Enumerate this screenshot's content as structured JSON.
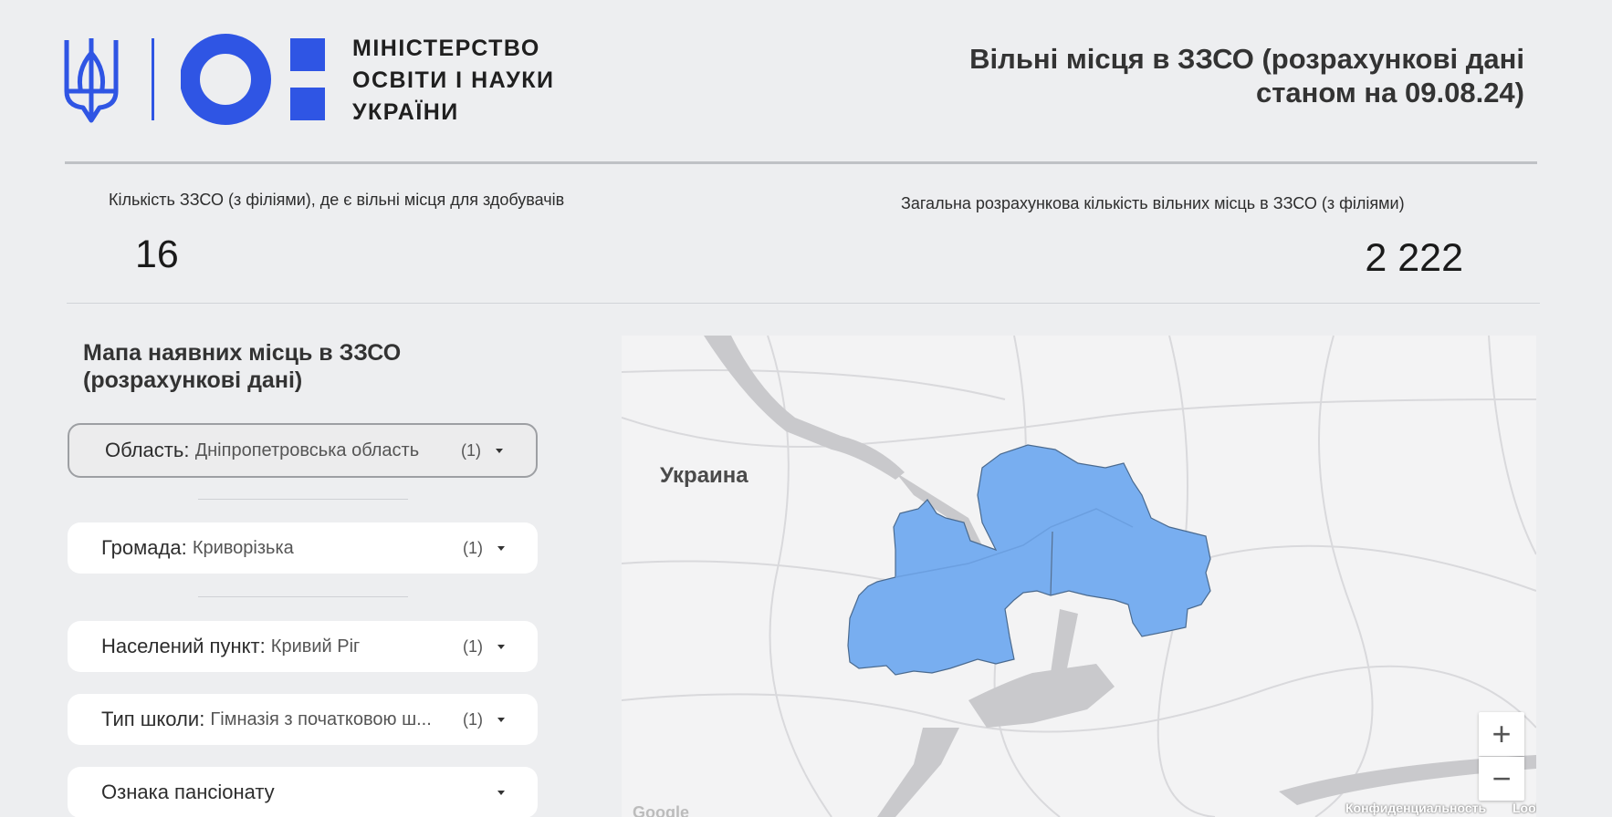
{
  "header": {
    "ministry_lines": [
      "МІНІСТЕРСТВО",
      "ОСВІТИ І НАУКИ",
      "УКРАЇНИ"
    ],
    "report_title_line1": "Вільні місця в ЗЗСО (розрахункові дані",
    "report_title_line2": "станом на 09.08.24)",
    "brand_color": "#2f55e4"
  },
  "kpis": [
    {
      "label": "Кількість ЗЗСО (з філіями), де є вільні місця для здобувачів",
      "value": "16"
    },
    {
      "label": "Загальна розрахункова кількість вільних місць в ЗЗСО (з філіями)",
      "value": "2 222"
    }
  ],
  "panel": {
    "title_line1": "Мапа наявних місць в ЗЗСО",
    "title_line2": "(розрахункові дані)"
  },
  "filters": [
    {
      "name": "Область",
      "value": "Дніпропетровська область",
      "count": "(1)",
      "active": true
    },
    {
      "name": "Громада",
      "value": "Криворізька",
      "count": "(1)"
    },
    {
      "name": "Населений пункт",
      "value": "Кривий Ріг",
      "count": "(1)"
    },
    {
      "name": "Тип школи",
      "value": "Гімназія з початковою ш...",
      "count": "(1)"
    },
    {
      "name": "Ознака пансіонату",
      "value": "",
      "count": ""
    }
  ],
  "map": {
    "country_label": "Украина",
    "zoom_in": "+",
    "zoom_out": "−",
    "attribution_google": "Google",
    "attribution_privacy": "Конфиденциальность",
    "attribution_studio": "Looker Studio",
    "highlight_color": "#78aef0"
  }
}
